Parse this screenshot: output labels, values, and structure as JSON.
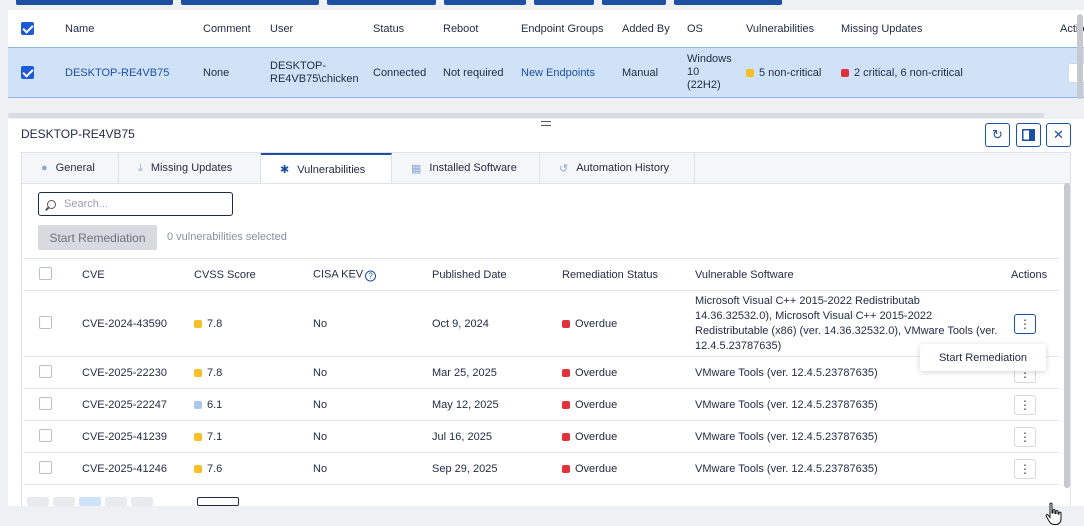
{
  "endpoints_grid": {
    "columns": [
      "Name",
      "Comment",
      "User",
      "Status",
      "Reboot",
      "Endpoint Groups",
      "Added By",
      "OS",
      "Vulnerabilities",
      "Missing Updates",
      "Actio"
    ],
    "row": {
      "name": "DESKTOP-RE4VB75",
      "comment": "None",
      "user_line1": "DESKTOP-",
      "user_line2": "RE4VB75\\chicken",
      "status": "Connected",
      "reboot": "Not required",
      "endpoint_groups": "New Endpoints",
      "added_by": "Manual",
      "os_line1": "Windows",
      "os_line2": "10",
      "os_line3": "(22H2)",
      "vulnerabilities": "5 non-critical",
      "missing_updates": "2 critical,  6 non-critical"
    }
  },
  "panel": {
    "title": "DESKTOP-RE4VB75",
    "tabs": [
      {
        "label": "General",
        "icon": "info-icon"
      },
      {
        "label": "Missing Updates",
        "icon": "download-icon"
      },
      {
        "label": "Vulnerabilities",
        "icon": "bug-icon"
      },
      {
        "label": "Installed Software",
        "icon": "grid-icon"
      },
      {
        "label": "Automation History",
        "icon": "history-icon"
      }
    ],
    "search_placeholder": "Search...",
    "start_remediation": "Start Remediation",
    "selected_count": "0 vulnerabilities selected",
    "columns": {
      "cve": "CVE",
      "cvss": "CVSS Score",
      "cisa": "CISA KEV",
      "published": "Published Date",
      "remediation": "Remediation Status",
      "software": "Vulnerable Software",
      "actions": "Actions"
    },
    "rows": [
      {
        "cve": "CVE-2024-43590",
        "cvss": "7.8",
        "cvss_color": "yellow",
        "kev": "No",
        "date": "Oct 9, 2024",
        "status": "Overdue",
        "software_l1": "Microsoft Visual C++ 2015-2022 Redistributab",
        "software_l2": "14.36.32532.0), Microsoft Visual C++ 2015-2022",
        "software_l3": "Redistributable (x86) (ver. 14.36.32532.0), VMware Tools (ver.",
        "software_l4": "12.4.5.23787635)"
      },
      {
        "cve": "CVE-2025-22230",
        "cvss": "7.8",
        "cvss_color": "yellow",
        "kev": "No",
        "date": "Mar 25, 2025",
        "status": "Overdue",
        "software": "VMware Tools (ver. 12.4.5.23787635)"
      },
      {
        "cve": "CVE-2025-22247",
        "cvss": "6.1",
        "cvss_color": "blue",
        "kev": "No",
        "date": "May 12, 2025",
        "status": "Overdue",
        "software": "VMware Tools (ver. 12.4.5.23787635)"
      },
      {
        "cve": "CVE-2025-41239",
        "cvss": "7.1",
        "cvss_color": "yellow",
        "kev": "No",
        "date": "Jul 16, 2025",
        "status": "Overdue",
        "software": "VMware Tools (ver. 12.4.5.23787635)"
      },
      {
        "cve": "CVE-2025-41246",
        "cvss": "7.6",
        "cvss_color": "yellow",
        "kev": "No",
        "date": "Sep 29, 2025",
        "status": "Overdue",
        "software": "VMware Tools (ver. 12.4.5.23787635)"
      }
    ],
    "tooltip": "Start Remediation",
    "kev_help": "?"
  },
  "colors": {
    "accent": "#1d4fa3",
    "selected_row": "#cfe2f8",
    "overdue": "#e0323c",
    "medium": "#f5c027"
  }
}
